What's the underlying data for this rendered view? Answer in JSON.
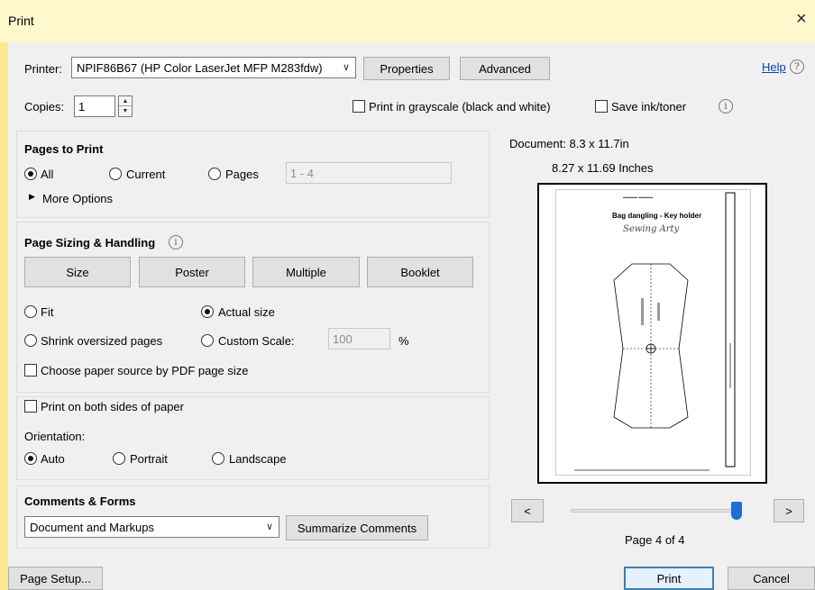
{
  "window": {
    "title": "Print",
    "close_glyph": "×"
  },
  "printer": {
    "label": "Printer:",
    "selected": "NPIF86B67 (HP Color LaserJet MFP M283fdw)",
    "properties_label": "Properties",
    "advanced_label": "Advanced",
    "help_label": "Help"
  },
  "copies": {
    "label": "Copies:",
    "value": "1"
  },
  "options": {
    "grayscale_label": "Print in grayscale (black and white)",
    "grayscale_checked": false,
    "save_ink_label": "Save ink/toner",
    "save_ink_checked": false
  },
  "pages_to_print": {
    "title": "Pages to Print",
    "all_label": "All",
    "current_label": "Current",
    "pages_label": "Pages",
    "range_placeholder": "1 - 4",
    "selected": "All",
    "more_options_label": "More Options"
  },
  "page_sizing": {
    "title": "Page Sizing & Handling",
    "size_label": "Size",
    "poster_label": "Poster",
    "multiple_label": "Multiple",
    "booklet_label": "Booklet",
    "fit_label": "Fit",
    "actual_size_label": "Actual size",
    "shrink_label": "Shrink oversized pages",
    "custom_scale_label": "Custom Scale:",
    "custom_scale_value": "100",
    "percent_label": "%",
    "selected": "Actual size",
    "paper_source_label": "Choose paper source by PDF page size"
  },
  "duplex": {
    "both_sides_label": "Print on both sides of paper",
    "orientation_label": "Orientation:",
    "auto_label": "Auto",
    "portrait_label": "Portrait",
    "landscape_label": "Landscape",
    "selected": "Auto"
  },
  "comments_forms": {
    "title": "Comments & Forms",
    "selected": "Document and Markups",
    "summarize_label": "Summarize Comments"
  },
  "preview": {
    "document_size": "Document: 8.3 x 11.7in",
    "paper_size": "8.27 x 11.69 Inches",
    "page_heading": "Bag dangling - Key holder",
    "page_script": "Sewing Arty",
    "page_indicator": "Page 4 of 4",
    "prev_label": "<",
    "next_label": ">",
    "slider_fraction": 1.0
  },
  "footer": {
    "page_setup_label": "Page Setup...",
    "print_label": "Print",
    "cancel_label": "Cancel"
  },
  "colors": {
    "accent": "#3c7fb1",
    "background_outer": "#fce98f",
    "dialog_bg": "#f0f0f0",
    "link": "#0645ad",
    "slider_thumb": "#1e6fd1"
  }
}
